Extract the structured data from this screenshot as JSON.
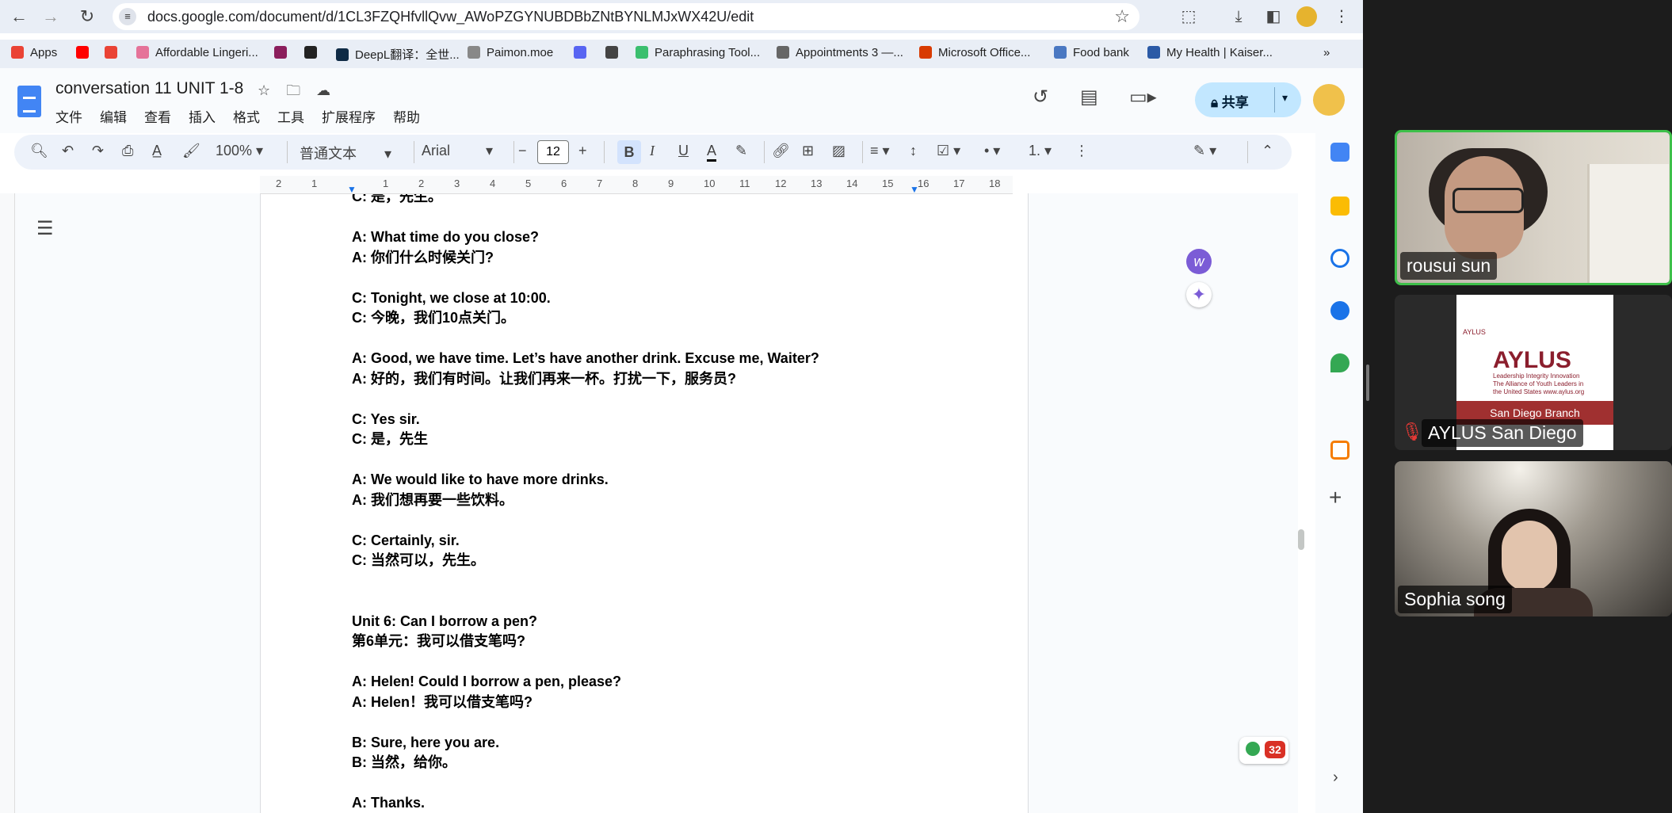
{
  "browser": {
    "url": "docs.google.com/document/d/1CL3FZQHfvllQvw_AWoPZGYNUBDBbZNtBYNLMJxWX42U/edit",
    "bookmarks": [
      {
        "label": "Apps",
        "color": "#ea4335"
      },
      {
        "label": "",
        "color": "#ff0000"
      },
      {
        "label": "",
        "color": "#ea4335"
      },
      {
        "label": "Affordable Lingeri...",
        "color": "#e57399"
      },
      {
        "label": "",
        "color": "#8b1e5c"
      },
      {
        "label": "",
        "color": "#222222"
      },
      {
        "label": "DeepL翻译：全世...",
        "color": "#0f2b46"
      },
      {
        "label": "Paimon.moe",
        "color": "#888888"
      },
      {
        "label": "",
        "color": "#5865f2"
      },
      {
        "label": "",
        "color": "#444444"
      },
      {
        "label": "Paraphrasing Tool...",
        "color": "#3bbf6f"
      },
      {
        "label": "Appointments 3 —...",
        "color": "#666666"
      },
      {
        "label": "Microsoft Office...",
        "color": "#d83b01"
      },
      {
        "label": "Food bank",
        "color": "#4a78c2"
      },
      {
        "label": "My Health | Kaiser...",
        "color": "#2b5aa6"
      }
    ],
    "bookmarks_more": "»"
  },
  "docs": {
    "title": "conversation 11 UNIT 1-8",
    "menu": [
      "文件",
      "编辑",
      "查看",
      "插入",
      "格式",
      "工具",
      "扩展程序",
      "帮助"
    ],
    "share_label": "共享",
    "toolbar": {
      "zoom": "100%",
      "style": "普通文本",
      "font": "Arial",
      "font_size": "12",
      "bold": "B",
      "italic": "I",
      "underline": "U",
      "text_color": "A"
    },
    "ruler_ticks": [
      "2",
      "1",
      "",
      "1",
      "2",
      "3",
      "4",
      "5",
      "6",
      "7",
      "8",
      "9",
      "10",
      "11",
      "12",
      "13",
      "14",
      "15",
      "16",
      "17",
      "18"
    ],
    "lines": [
      {
        "text": "C: 是，先生。",
        "blank": false
      },
      {
        "text": "",
        "blank": true
      },
      {
        "text": "A: What time do you close?",
        "blank": false
      },
      {
        "text": "A: 你们什么时候关门?",
        "blank": false
      },
      {
        "text": "",
        "blank": true
      },
      {
        "text": "C: Tonight, we close at 10:00.",
        "blank": false
      },
      {
        "text": "C: 今晚，我们10点关门。",
        "blank": false
      },
      {
        "text": "",
        "blank": true
      },
      {
        "text": "A: Good, we have time. Let’s have another drink. Excuse me, Waiter?",
        "blank": false
      },
      {
        "text": "A: 好的，我们有时间。让我们再来一杯。打扰一下，服务员?",
        "blank": false
      },
      {
        "text": "",
        "blank": true
      },
      {
        "text": "C: Yes sir.",
        "blank": false
      },
      {
        "text": "C: 是，先生",
        "blank": false
      },
      {
        "text": "",
        "blank": true
      },
      {
        "text": "A: We would like to have more drinks.",
        "blank": false
      },
      {
        "text": "A: 我们想再要一些饮料。",
        "blank": false
      },
      {
        "text": "",
        "blank": true
      },
      {
        "text": "C: Certainly, sir.",
        "blank": false
      },
      {
        "text": "C: 当然可以，先生。",
        "blank": false
      },
      {
        "text": "",
        "blank": true
      },
      {
        "text": "",
        "blank": true
      },
      {
        "text": "Unit 6: Can I borrow a pen?",
        "blank": false
      },
      {
        "text": "第6单元：我可以借支笔吗?",
        "blank": false
      },
      {
        "text": "",
        "blank": true
      },
      {
        "text": "A: Helen! Could I borrow a pen, please?",
        "blank": false
      },
      {
        "text": "A: Helen！我可以借支笔吗?",
        "blank": false
      },
      {
        "text": "",
        "blank": true
      },
      {
        "text": "B: Sure, here you are.",
        "blank": false
      },
      {
        "text": "B: 当然，给你。",
        "blank": false
      },
      {
        "text": "",
        "blank": true
      },
      {
        "text": "A: Thanks.",
        "blank": false
      }
    ],
    "notification_count": "32"
  },
  "zoom": {
    "participants": [
      {
        "name": "rousui sun",
        "active": true
      },
      {
        "name": "AYLUS San Diego",
        "muted": true
      },
      {
        "name": "Sophia song"
      }
    ],
    "aylus_card": {
      "small": "AYLUS",
      "logo": "AYLUS",
      "tagline": "Leadership Integrity Innovation The Alliance of Youth Leaders in the United States www.aylus.org",
      "branch": "San Diego Branch"
    }
  },
  "colors": {
    "accent": "#1a73e8",
    "share_bg": "#c2e7ff",
    "active_speaker": "#3ec04a"
  }
}
